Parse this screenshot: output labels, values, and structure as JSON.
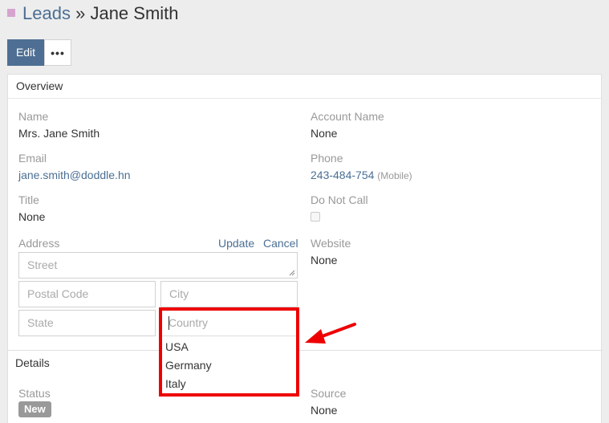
{
  "header": {
    "entity": "Leads",
    "separator": "»",
    "record_name": "Jane Smith"
  },
  "toolbar": {
    "edit_label": "Edit",
    "more_label": "•••"
  },
  "overview": {
    "title": "Overview",
    "name_label": "Name",
    "name_value": "Mrs. Jane Smith",
    "account_label": "Account Name",
    "account_value": "None",
    "email_label": "Email",
    "email_value": "jane.smith@doddle.hn",
    "phone_label": "Phone",
    "phone_value": "243-484-754",
    "phone_type": "(Mobile)",
    "title_label": "Title",
    "title_value": "None",
    "dnc_label": "Do Not Call",
    "website_label": "Website",
    "website_value": "None",
    "address": {
      "label": "Address",
      "update_label": "Update",
      "cancel_label": "Cancel",
      "street_placeholder": "Street",
      "postal_placeholder": "Postal Code",
      "city_placeholder": "City",
      "state_placeholder": "State",
      "country_placeholder": "Country",
      "country_options": [
        "USA",
        "Germany",
        "Italy"
      ]
    }
  },
  "details": {
    "title": "Details",
    "status_label": "Status",
    "status_value": "New",
    "source_label": "Source",
    "source_value": "None"
  },
  "colors": {
    "accent": "#4e6f93",
    "link": "#4b6f94",
    "highlight": "#ee0000",
    "entity_square": "#d6a3cf"
  }
}
